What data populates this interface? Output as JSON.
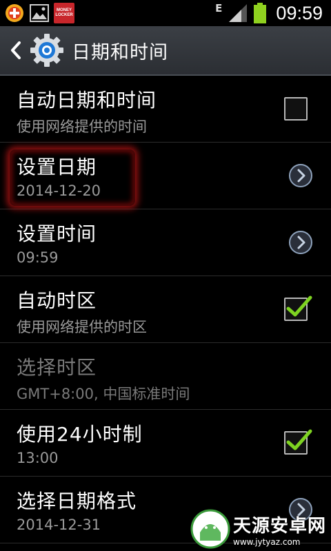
{
  "status_bar": {
    "network_type": "E",
    "time": "09:59",
    "money_locker_line1": "MONEY",
    "money_locker_line2": "LOCKER"
  },
  "action_bar": {
    "title": "日期和时间"
  },
  "settings": [
    {
      "title": "自动日期和时间",
      "subtitle": "使用网络提供的时间",
      "control": "checkbox",
      "checked": false
    },
    {
      "title": "设置日期",
      "subtitle": "2014-12-20",
      "control": "chevron"
    },
    {
      "title": "设置时间",
      "subtitle": "09:59",
      "control": "chevron"
    },
    {
      "title": "自动时区",
      "subtitle": "使用网络提供的时区",
      "control": "checkbox",
      "checked": true
    },
    {
      "title": "选择时区",
      "subtitle": "GMT+8:00, 中国标准时间",
      "control": "none",
      "disabled": true
    },
    {
      "title": "使用24小时制",
      "subtitle": "13:00",
      "control": "checkbox",
      "checked": true
    },
    {
      "title": "选择日期格式",
      "subtitle": "2014-12-31",
      "control": "chevron"
    }
  ],
  "watermark": {
    "name": "天源安卓网",
    "url": "www.jytyaz.com"
  },
  "colors": {
    "check_green": "#7ed321",
    "battery_green": "#8fd11f",
    "highlight_red": "#b41414"
  }
}
